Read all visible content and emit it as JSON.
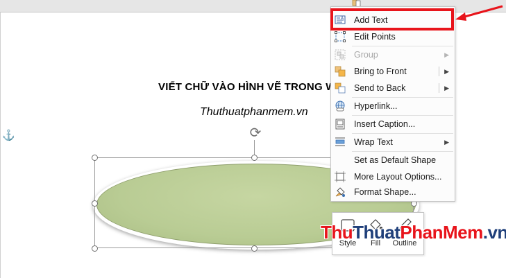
{
  "document": {
    "title": "VIẾT CHỮ VÀO HÌNH VẼ TRONG WORD",
    "subtitle": "Thuthuatphanmem.vn",
    "anchor_icon": "anchor-icon"
  },
  "context_menu": {
    "items": [
      {
        "label": "Add Text",
        "icon": "add-text-icon"
      },
      {
        "label": "Edit Points",
        "icon": "edit-points-icon"
      },
      {
        "label": "Group",
        "icon": "group-icon",
        "disabled": true
      },
      {
        "label": "Bring to Front",
        "icon": "bring-to-front-icon"
      },
      {
        "label": "Send to Back",
        "icon": "send-to-back-icon"
      },
      {
        "label": "Hyperlink...",
        "icon": "hyperlink-icon"
      },
      {
        "label": "Insert Caption...",
        "icon": "insert-caption-icon"
      },
      {
        "label": "Wrap Text",
        "icon": "wrap-text-icon"
      },
      {
        "label": "Set as Default Shape",
        "icon": ""
      },
      {
        "label": "More Layout Options...",
        "icon": "layout-options-icon"
      },
      {
        "label": "Format Shape...",
        "icon": "format-shape-icon"
      }
    ]
  },
  "mini_toolbar": {
    "style_label": "Style",
    "fill_label": "Fill",
    "outline_label": "Outline"
  },
  "watermark": {
    "part1": "Thu",
    "part2": "Thuat",
    "part3": "PhanMem",
    "part4": ".vn"
  },
  "colors": {
    "highlight": "#e8141b",
    "shape_fill": "#bccf98",
    "watermark_red": "#e8141b",
    "watermark_dark": "#1f3f7a"
  }
}
